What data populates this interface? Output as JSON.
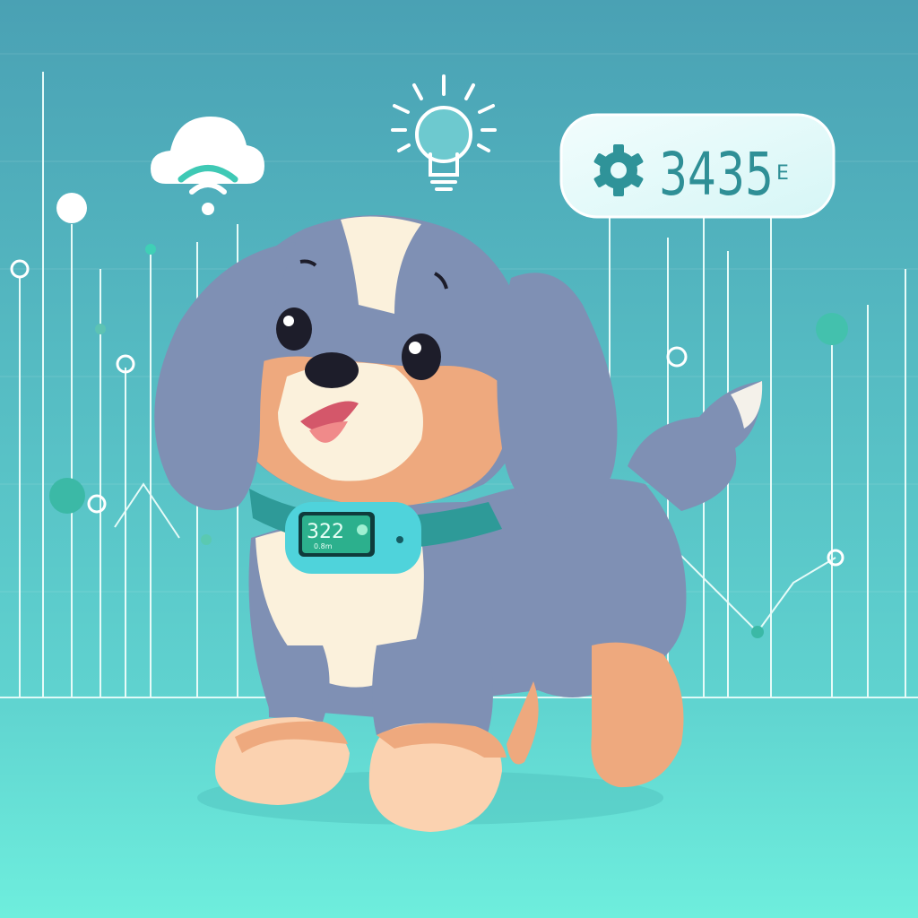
{
  "stat_badge": {
    "icon": "gear-icon",
    "value": "3435",
    "suffix": "E"
  },
  "collar_tracker": {
    "display_value": "322",
    "display_subtext": "0.8m"
  },
  "icons": [
    "cloud-wifi-icon",
    "lightbulb-icon",
    "gear-icon"
  ],
  "colors": {
    "background_top": "#4aa1b4",
    "background_bottom": "#6eeedd",
    "badge_text": "#2f8f96",
    "dog_fur": "#7f90b4",
    "dog_tan": "#eea97e",
    "dog_cream": "#fbf1dc",
    "collar": "#2e9a98",
    "tracker": "#4fd3db"
  }
}
